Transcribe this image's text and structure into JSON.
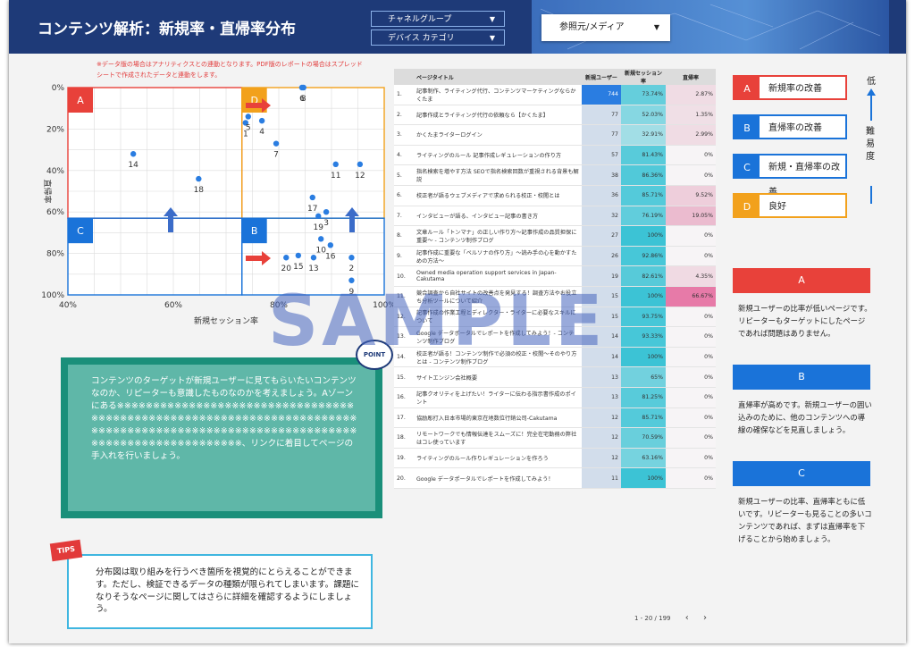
{
  "header": {
    "title": "コンテンツ解析：新規率・直帰率分布",
    "filter_channel": "チャネルグループ",
    "filter_device": "デバイス カテゴリ",
    "filter_source": "参照元/メディア"
  },
  "note": "※データ版の場合はアナリティクスとの連動となります。PDF版のレポートの場合はスプレッドシートで作成されたデータと連動をします。",
  "chart_data": {
    "type": "scatter",
    "xlabel": "新規セッション率",
    "ylabel": "直帰率",
    "xlim": [
      40,
      100
    ],
    "ylim": [
      0,
      100
    ],
    "x_ticks": [
      "40%",
      "60%",
      "80%",
      "100%"
    ],
    "y_ticks": [
      "0%",
      "20%",
      "40%",
      "60%",
      "80%",
      "100%"
    ],
    "zones": [
      "A",
      "D",
      "C",
      "B"
    ],
    "points": [
      {
        "label": "1",
        "x": 73.7,
        "y": 17
      },
      {
        "label": "2",
        "x": 93.8,
        "y": 82
      },
      {
        "label": "3",
        "x": 89.0,
        "y": 60
      },
      {
        "label": "4",
        "x": 76.8,
        "y": 16
      },
      {
        "label": "5",
        "x": 74.2,
        "y": 14
      },
      {
        "label": "6",
        "x": 84.4,
        "y": 0
      },
      {
        "label": "7",
        "x": 79.5,
        "y": 27
      },
      {
        "label": "8",
        "x": 84.7,
        "y": 0
      },
      {
        "label": "9",
        "x": 93.8,
        "y": 93
      },
      {
        "label": "10",
        "x": 88.0,
        "y": 73
      },
      {
        "label": "11",
        "x": 90.8,
        "y": 37
      },
      {
        "label": "12",
        "x": 95.4,
        "y": 37
      },
      {
        "label": "13",
        "x": 86.6,
        "y": 82
      },
      {
        "label": "14",
        "x": 52.4,
        "y": 32
      },
      {
        "label": "15",
        "x": 83.7,
        "y": 81
      },
      {
        "label": "16",
        "x": 89.8,
        "y": 76
      },
      {
        "label": "17",
        "x": 86.4,
        "y": 53
      },
      {
        "label": "18",
        "x": 64.8,
        "y": 44
      },
      {
        "label": "19",
        "x": 87.5,
        "y": 62
      },
      {
        "label": "20",
        "x": 81.4,
        "y": 82
      }
    ]
  },
  "table": {
    "headers": [
      "ページタイトル",
      "新規ユーザー",
      "新規セッション率",
      "直帰率"
    ],
    "rows": [
      [
        "1.",
        "記事制作、ライティング代行、コンテンツマーケティングならかくたま",
        "744",
        "73.74%",
        "2.87%"
      ],
      [
        "2.",
        "記事作成とライティング代行の依頼なら【かくたま】",
        "77",
        "52.03%",
        "1.35%"
      ],
      [
        "3.",
        "かくたまライターログイン",
        "77",
        "32.91%",
        "2.99%"
      ],
      [
        "4.",
        "ライティングのルール 記事作成レギュレーションの作り方",
        "57",
        "81.43%",
        "0%"
      ],
      [
        "5.",
        "指名検索を増やす方法 SEOで指名検索回数が重視される背景も解説",
        "38",
        "86.36%",
        "0%"
      ],
      [
        "6.",
        "校正者が語るウェブメディアで求められる校正・校閲とは",
        "36",
        "85.71%",
        "9.52%"
      ],
      [
        "7.",
        "インタビューが語る、インタビュー記事の書き方",
        "32",
        "76.19%",
        "19.05%"
      ],
      [
        "8.",
        "文章ルール「トンマナ」の正しい作り方〜記事作成の品質担保に重要〜 - コンテンツ制作ブログ",
        "27",
        "100%",
        "0%"
      ],
      [
        "9.",
        "記事作成に重要な「ペルソナの作り方」〜読み手の心を動かすための方法〜",
        "26",
        "92.86%",
        "0%"
      ],
      [
        "10.",
        "Owned media operation support services in Japan-Cakutama",
        "19",
        "82.61%",
        "4.35%"
      ],
      [
        "11.",
        "競合調査から自社サイトの改善点を発見する！調査方法やお役立ち分析ツールについて紹介",
        "15",
        "100%",
        "66.67%"
      ],
      [
        "12.",
        "記事作成の作業工程とディレクター・ライターに必要なスキルについて",
        "15",
        "93.75%",
        "0%"
      ],
      [
        "13.",
        "Google データポータルでレポートを作成してみよう！- コンテンツ制作ブログ",
        "14",
        "93.33%",
        "0%"
      ],
      [
        "14.",
        "校正者が語る！コンテンツ制作で必須の校正・校閲〜そのやり方とは - コンテンツ制作ブログ",
        "14",
        "100%",
        "0%"
      ],
      [
        "15.",
        "サイトエンジン会社概要",
        "13",
        "65%",
        "0%"
      ],
      [
        "16.",
        "記事クオリティを上げたい！ライターに伝わる指示書作成のポイント",
        "13",
        "81.25%",
        "0%"
      ],
      [
        "17.",
        "協励彫打入日本市場的東京在地数位行銷公司-Cakutama",
        "12",
        "85.71%",
        "0%"
      ],
      [
        "18.",
        "リモートワークでも情報伝達をスムーズに！完全在宅勤務の弊社はコレ使っています",
        "12",
        "70.59%",
        "0%"
      ],
      [
        "19.",
        "ライティングのルール作りレギュレーションを作ろう",
        "12",
        "63.16%",
        "0%"
      ],
      [
        "20.",
        "Google データポータルでレポートを作成してみよう！",
        "11",
        "100%",
        "0%"
      ]
    ],
    "pager": "1 - 20 / 199"
  },
  "legend": [
    {
      "key": "A",
      "label": "新規率の改善",
      "color": "#e8413a"
    },
    {
      "key": "B",
      "label": "直帰率の改善",
      "color": "#1a73d9"
    },
    {
      "key": "C",
      "label": "新規・直帰率の改善",
      "color": "#1a73d9"
    },
    {
      "key": "D",
      "label": "良好",
      "color": "#f2a11c"
    }
  ],
  "difficulty": {
    "low": "低",
    "label": "難易度"
  },
  "descriptions": [
    {
      "key": "A",
      "color": "#e8413a",
      "text": "新規ユーザーの比率が低いページです。リピーターもターゲットにしたページであれば問題はありません。"
    },
    {
      "key": "B",
      "color": "#1a73d9",
      "text": "直帰率が高めです。新規ユーザーの囲い込みのために、他のコンテンツへの導線の確保などを見直しましょう。"
    },
    {
      "key": "C",
      "color": "#1a73d9",
      "text": "新規ユーザーの比率、直帰率ともに低いです。リピーターも見ることの多いコンテンツであれば、まずは直帰率を下げることから始めましょう。"
    }
  ],
  "point_label": "POINT",
  "content_text": "コンテンツのターゲットが新規ユーザーに見てもらいたいコンテンツなのか、リピーターも意識したものなのかを考えましょう。Aゾーンにある※※※※※※※※※※※※※※※※※※※※※※※※※※※※※※※※※※※※※※※※※※※※※※※※※※※※※※※※※※※※※※※※※※※※※※※※※※※※※※※※※※※※※※※※※※※※※※※※※※※※※※※※※※※※※※※※※※※※※※※※※※※※※※※※、リンクに着目してページの手入れを行いましょう。",
  "tips_label": "TIPS",
  "tips_text": "分布図は取り組みを行うべき箇所を視覚的にとらえることができます。ただし、検証できるデータの種類が限られてしまいます。課題になりそうなページに関してはさらに詳細を確認するようにしましょう。",
  "watermark": "SAMPLE"
}
